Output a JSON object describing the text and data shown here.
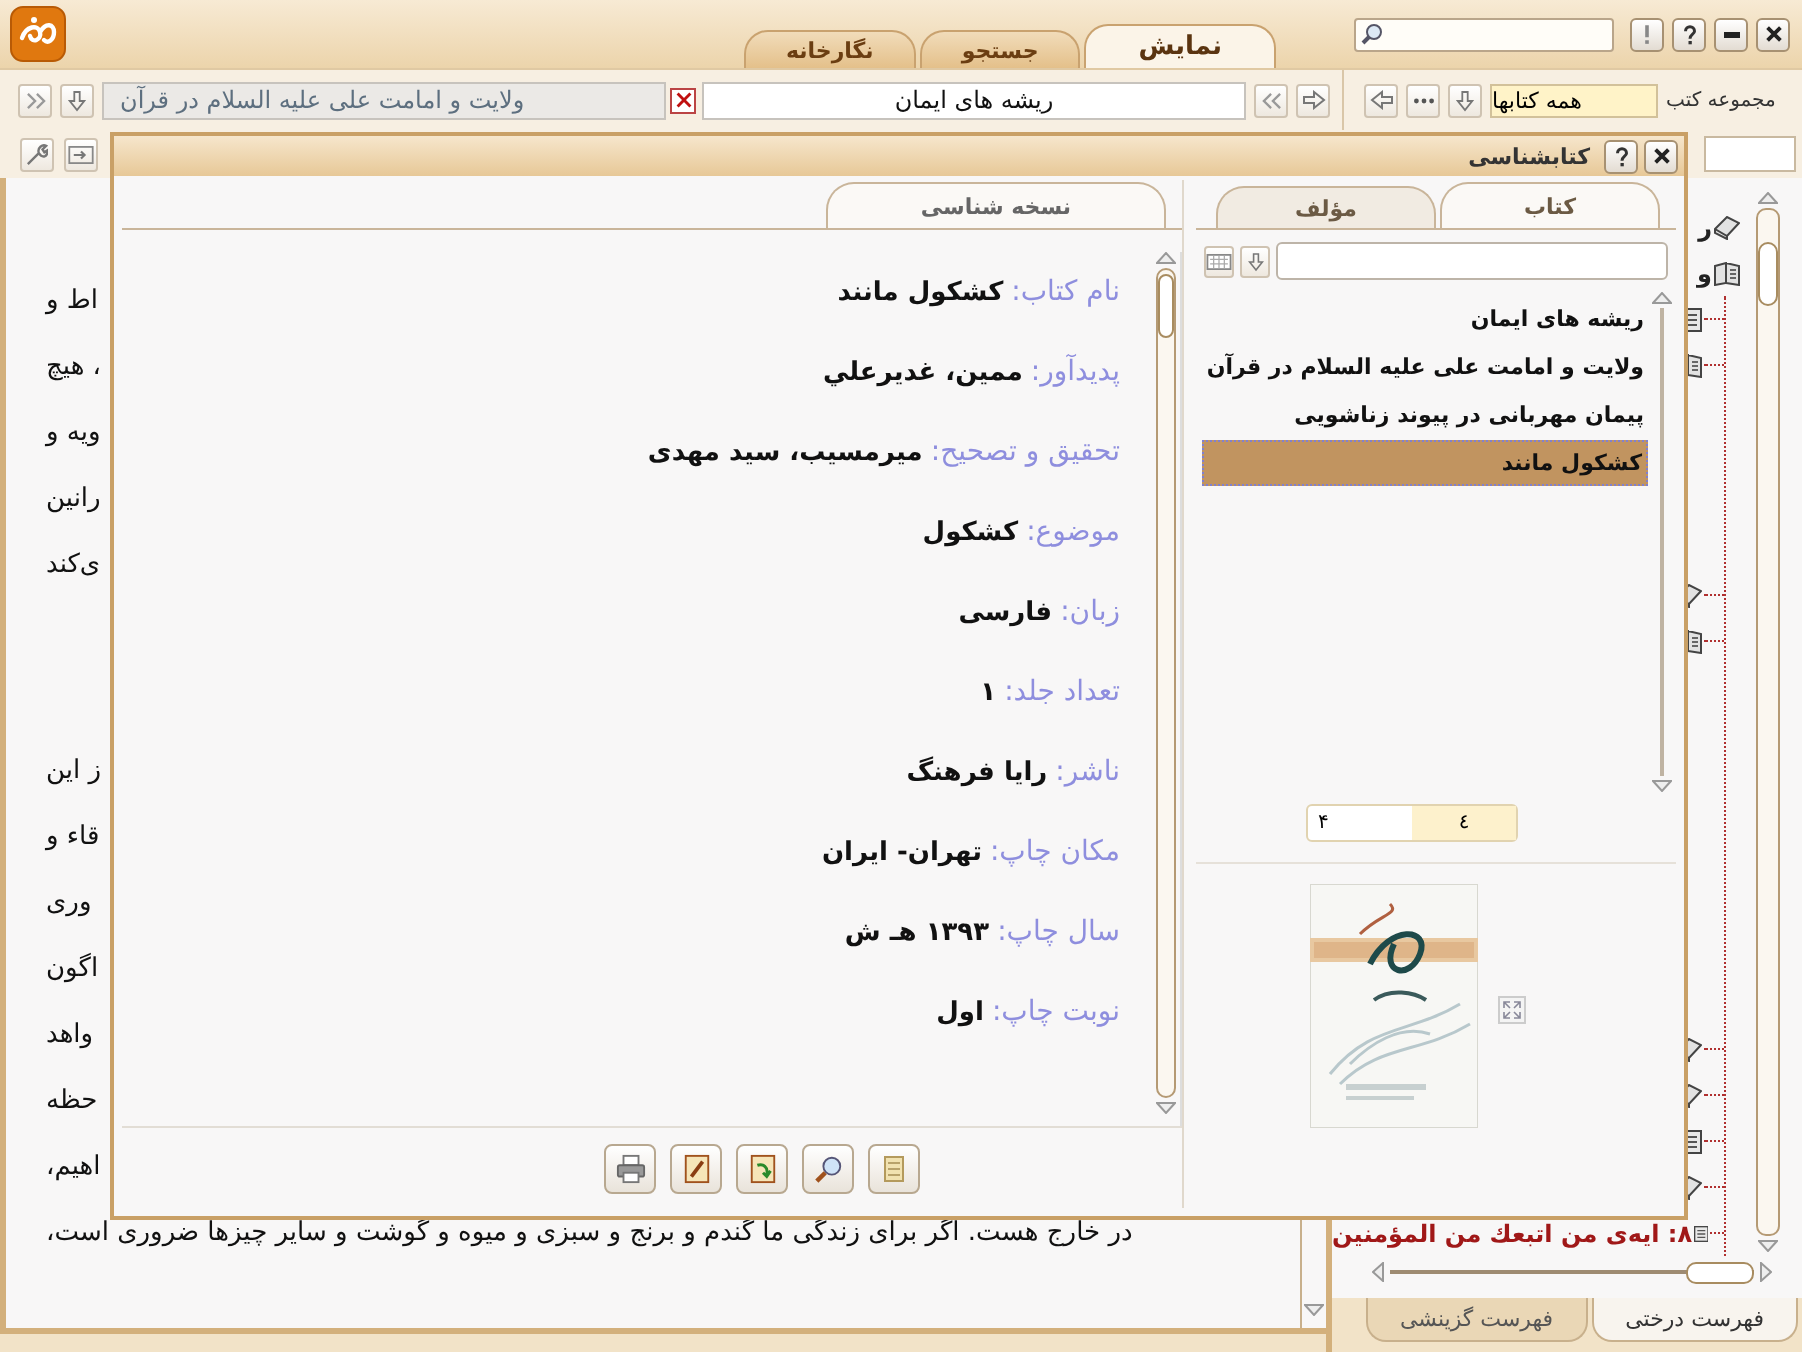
{
  "app_tabs": [
    {
      "label": "نمایش",
      "selected": true
    },
    {
      "label": "جستجو",
      "selected": false
    },
    {
      "label": "نگارخانه",
      "selected": false
    }
  ],
  "library": {
    "label": "مجموعه کتب",
    "value": "همه کتابها"
  },
  "open_books": [
    {
      "title": "ریشه های ایمان",
      "selected": true
    },
    {
      "title": "ولایت و امامت علی علیه السلام در قرآن",
      "selected": false
    }
  ],
  "reader": {
    "paragraphs": [
      [
        "اط و",
        "، هیچ",
        "ویه و",
        "رانین",
        "ی‌کند"
      ],
      [
        "ز این",
        "قاء و",
        "وری",
        "اگون",
        "واهد",
        "حظه",
        "اهیم،",
        "در خارج هست. اگر برای زندگی ما گندم و برنج و سبزی و میوه و گوشت و سایر چیزها ضروری است،"
      ]
    ]
  },
  "contents": {
    "items": [
      {
        "kind": "closed-book",
        "label": "ر"
      },
      {
        "kind": "open-book",
        "label": "و",
        "children": [
          {
            "kind": "page"
          },
          {
            "kind": "open-book"
          },
          {
            "kind": "closed-book"
          },
          {
            "kind": "open-book"
          },
          {
            "kind": "closed-book"
          },
          {
            "kind": "closed-book"
          },
          {
            "kind": "page"
          },
          {
            "kind": "closed-book"
          },
          {
            "kind": "page",
            "label": "۸: ایه‌ی من اتبعك من المؤمنین",
            "highlighted": true
          }
        ]
      }
    ],
    "tabs": [
      {
        "label": "فهرست درختی",
        "selected": true
      },
      {
        "label": "فهرست گزینشی",
        "selected": false
      }
    ]
  },
  "dialog": {
    "title": "کتابشناسی",
    "detail_tabs": [
      {
        "label": "نسخه شناسی",
        "selected": true
      }
    ],
    "fields": [
      {
        "label": "نام کتاب:",
        "value": "کشکول مانند"
      },
      {
        "label": "پدیدآور:",
        "value": "ممین، غدیرعلي"
      },
      {
        "label": "تحقیق و تصحیح:",
        "value": "میرمسیب، سید مهدی"
      },
      {
        "label": "موضوع:",
        "value": "کشکول"
      },
      {
        "label": "زبان:",
        "value": "فارسی"
      },
      {
        "label": "تعداد جلد:",
        "value": "۱"
      },
      {
        "label": "ناشر:",
        "value": "رایا فرهنگ"
      },
      {
        "label": "مکان چاپ:",
        "value": "تهران- ایران"
      },
      {
        "label": "سال چاپ:",
        "value": "۱۳۹۳ هـ ش"
      },
      {
        "label": "نوبت چاپ:",
        "value": "اول"
      }
    ],
    "search_tabs": [
      {
        "label": "کتاب",
        "selected": true
      },
      {
        "label": "مؤلف",
        "selected": false
      }
    ],
    "books": [
      {
        "title": "ریشه های ایمان",
        "selected": false
      },
      {
        "title": "ولایت و امامت علی علیه السلام در قرآن",
        "selected": false
      },
      {
        "title": "پیمان مهربانی در پیوند زناشویی",
        "selected": false
      },
      {
        "title": "کشکول مانند",
        "selected": true
      }
    ],
    "pager": {
      "value": "٤",
      "count": "۴"
    }
  }
}
